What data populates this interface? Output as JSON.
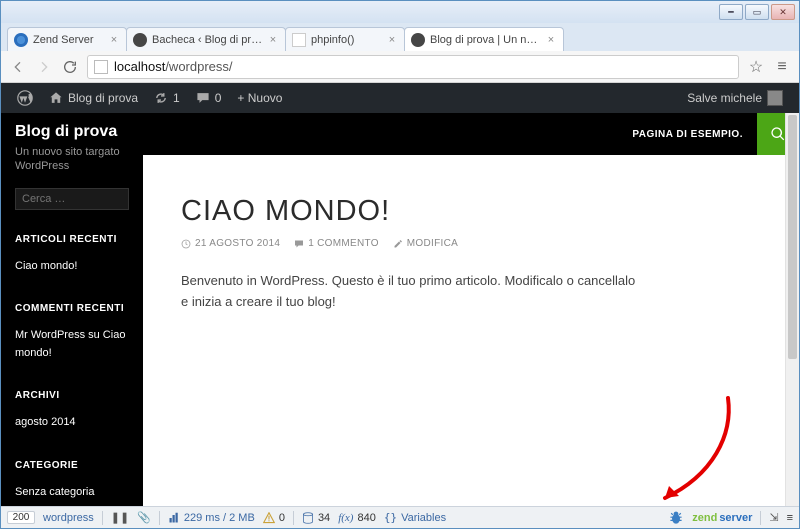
{
  "browser": {
    "tabs": [
      {
        "label": "Zend Server",
        "favicon": "zend"
      },
      {
        "label": "Bacheca ‹ Blog di prova — W",
        "favicon": "wp"
      },
      {
        "label": "phpinfo()",
        "favicon": "blank"
      },
      {
        "label": "Blog di prova | Un nuovo sito",
        "favicon": "wp",
        "active": true
      }
    ],
    "url_proto": "",
    "url_host": "localhost",
    "url_path": "/wordpress/"
  },
  "wpadmin": {
    "site_name": "Blog di prova",
    "updates": "1",
    "comments": "0",
    "new_label": "+ Nuovo",
    "greeting": "Salve michele"
  },
  "sidebar": {
    "title": "Blog di prova",
    "tagline": "Un nuovo sito targato WordPress",
    "search_placeholder": "Cerca …",
    "widgets": {
      "recent_posts": {
        "heading": "ARTICOLI RECENTI",
        "items": [
          "Ciao mondo!"
        ]
      },
      "recent_comments": {
        "heading": "COMMENTI RECENTI",
        "items_html": "Mr WordPress su Ciao mondo!"
      },
      "archives": {
        "heading": "ARCHIVI",
        "items": [
          "agosto 2014"
        ]
      },
      "categories": {
        "heading": "CATEGORIE",
        "items": [
          "Senza categoria"
        ]
      }
    }
  },
  "header_menu": {
    "sample_page": "PAGINA DI ESEMPIO."
  },
  "article": {
    "title": "CIAO MONDO!",
    "date": "21 AGOSTO 2014",
    "comments": "1 COMMENTO",
    "edit": "MODIFICA",
    "body": "Benvenuto in WordPress. Questo è il tuo primo articolo. Modificalo o cancellalo e inizia a creare il tuo blog!"
  },
  "devbar": {
    "status_code": "200",
    "route": "wordpress",
    "time_mem": "229 ms / 2 MB",
    "warnings": "0",
    "db": "34",
    "fx_label": "f(x)",
    "fx_count": "840",
    "vars_label": "Variables",
    "brand1": "zend",
    "brand2": "server"
  }
}
